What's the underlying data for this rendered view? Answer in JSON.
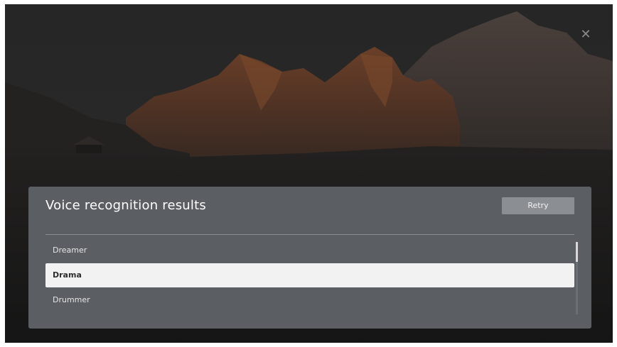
{
  "dialog": {
    "title": "Voice recognition results",
    "retry_label": "Retry",
    "close_icon": "close-icon"
  },
  "results": [
    {
      "label": "Dreamer",
      "selected": false
    },
    {
      "label": "Drama",
      "selected": true
    },
    {
      "label": "Drummer",
      "selected": false
    }
  ],
  "colors": {
    "panel": "#5b5f63",
    "selected_row": "#f2f2f2",
    "retry_button": "#8b8f94"
  }
}
